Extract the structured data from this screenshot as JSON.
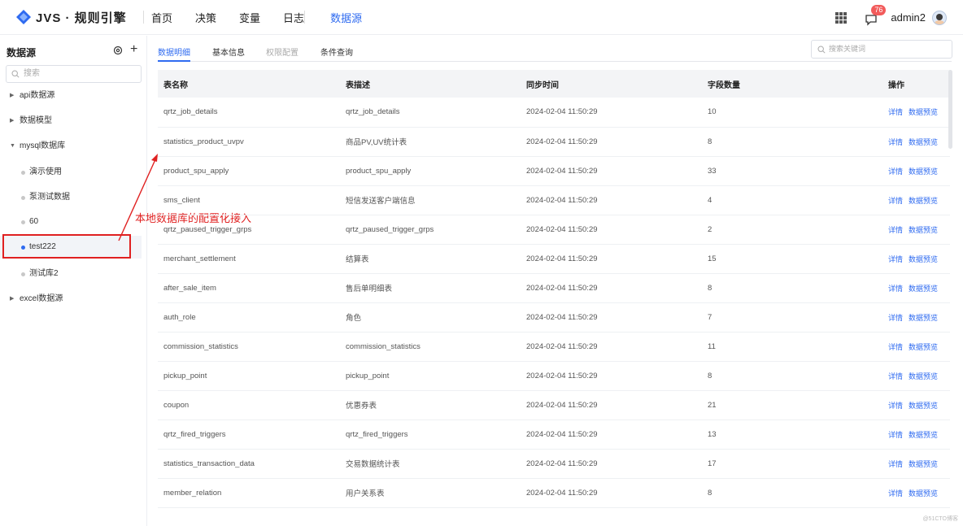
{
  "header": {
    "logo_text": "JVS · 规则引擎",
    "nav": [
      "首页",
      "决策",
      "变量",
      "日志",
      "数据源"
    ],
    "active_nav": "数据源",
    "message_count": "76",
    "user_name": "admin2"
  },
  "sidebar": {
    "title": "数据源",
    "search_placeholder": "搜索",
    "items": [
      {
        "label": "api数据源",
        "level": 0,
        "expanded": false
      },
      {
        "label": "数据模型",
        "level": 0,
        "expanded": false
      },
      {
        "label": "mysql数据库",
        "level": 0,
        "expanded": true
      },
      {
        "label": "演示使用",
        "level": 1
      },
      {
        "label": "泵测试数据",
        "level": 1
      },
      {
        "label": "60",
        "level": 1
      },
      {
        "label": "test222",
        "level": 1,
        "selected": true
      },
      {
        "label": "测试库2",
        "level": 1
      },
      {
        "label": "excel数据源",
        "level": 0,
        "expanded": false
      }
    ]
  },
  "annotation": {
    "text": "本地数据库的配置化接入",
    "color": "#e02020"
  },
  "tabs": [
    {
      "label": "数据明细",
      "state": "active"
    },
    {
      "label": "基本信息",
      "state": "normal"
    },
    {
      "label": "权限配置",
      "state": "disabled"
    },
    {
      "label": "条件查询",
      "state": "normal"
    }
  ],
  "main_search_placeholder": "搜索关键词",
  "table": {
    "columns": [
      "表名称",
      "表描述",
      "同步时间",
      "字段数量",
      "操作"
    ],
    "action_detail": "详情",
    "action_preview": "数据预览",
    "rows": [
      [
        "qrtz_job_details",
        "qrtz_job_details",
        "2024-02-04 11:50:29",
        "10"
      ],
      [
        "statistics_product_uvpv",
        "商品PV,UV统计表",
        "2024-02-04 11:50:29",
        "8"
      ],
      [
        "product_spu_apply",
        "product_spu_apply",
        "2024-02-04 11:50:29",
        "33"
      ],
      [
        "sms_client",
        "短信发送客户端信息",
        "2024-02-04 11:50:29",
        "4"
      ],
      [
        "qrtz_paused_trigger_grps",
        "qrtz_paused_trigger_grps",
        "2024-02-04 11:50:29",
        "2"
      ],
      [
        "merchant_settlement",
        "结算表",
        "2024-02-04 11:50:29",
        "15"
      ],
      [
        "after_sale_item",
        "售后单明细表",
        "2024-02-04 11:50:29",
        "8"
      ],
      [
        "auth_role",
        "角色",
        "2024-02-04 11:50:29",
        "7"
      ],
      [
        "commission_statistics",
        "commission_statistics",
        "2024-02-04 11:50:29",
        "11"
      ],
      [
        "pickup_point",
        "pickup_point",
        "2024-02-04 11:50:29",
        "8"
      ],
      [
        "coupon",
        "优惠券表",
        "2024-02-04 11:50:29",
        "21"
      ],
      [
        "qrtz_fired_triggers",
        "qrtz_fired_triggers",
        "2024-02-04 11:50:29",
        "13"
      ],
      [
        "statistics_transaction_data",
        "交易数据统计表",
        "2024-02-04 11:50:29",
        "17"
      ],
      [
        "member_relation",
        "用户关系表",
        "2024-02-04 11:50:29",
        "8"
      ]
    ]
  },
  "watermark": "@51CTO博客",
  "colors": {
    "accent": "#2f6bf0",
    "annotation": "#e02020",
    "badge": "#f25b5b"
  }
}
